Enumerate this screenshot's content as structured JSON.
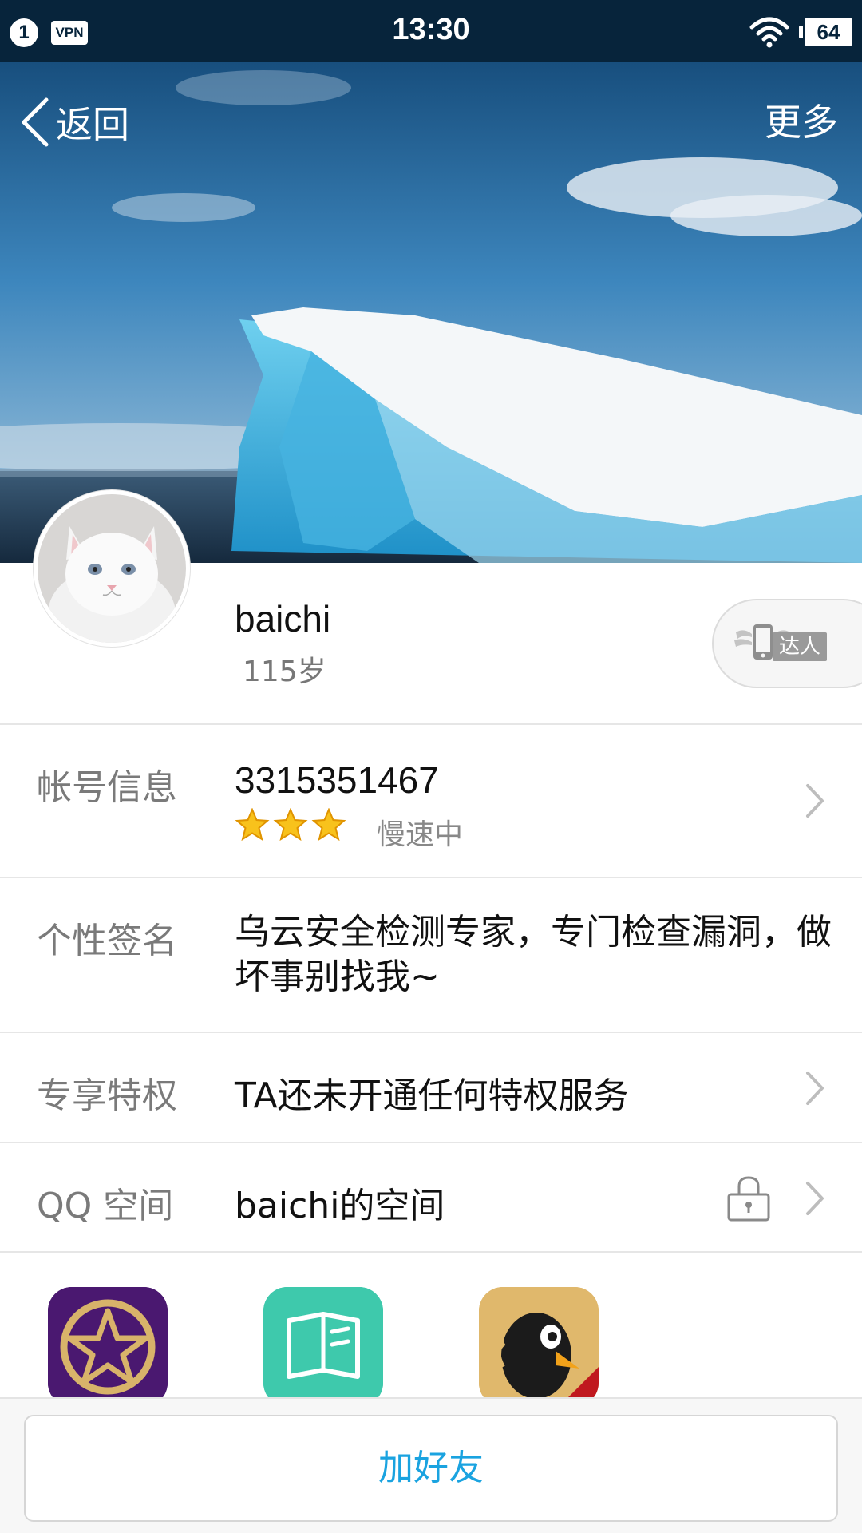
{
  "status_bar": {
    "notification_count": "1",
    "vpn_label": "VPN",
    "time": "13:30",
    "battery": "64"
  },
  "nav": {
    "back_label": "返回",
    "more_label": "更多"
  },
  "profile": {
    "nickname": "baichi",
    "age": "115岁",
    "talent_label": "达人"
  },
  "account": {
    "label": "帐号信息",
    "qq_number": "3315351467",
    "level_stars": 3,
    "level_status": "慢速中"
  },
  "signature": {
    "label": "个性签名",
    "text": "乌云安全检测专家，专门检查漏洞，做坏事别找我~"
  },
  "privilege": {
    "label": "专享特权",
    "text": "TA还未开通任何特权服务"
  },
  "qzone": {
    "label": "QQ 空间",
    "text": "baichi的空间"
  },
  "apps": [
    {
      "icon": "star-game-icon",
      "color": "#4a1870"
    },
    {
      "icon": "book-icon",
      "color": "#3ec9ac"
    },
    {
      "icon": "penguin-music-icon",
      "color": "#e0b86c"
    }
  ],
  "bottom": {
    "add_friend_label": "加好友"
  },
  "colors": {
    "accent": "#1aa3e0",
    "status_bar_bg": "#07243b"
  }
}
